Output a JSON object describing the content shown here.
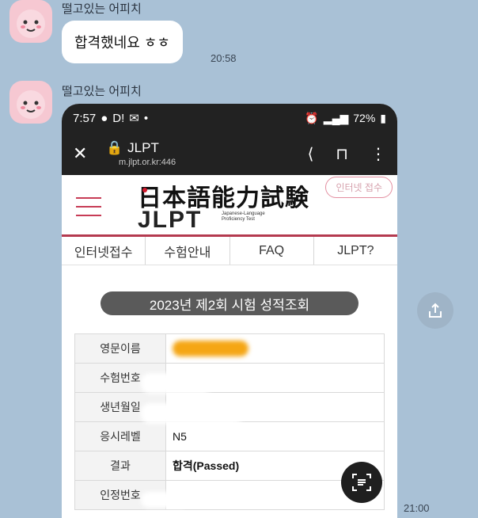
{
  "chat": {
    "sender_name": "떨고있는 어피치",
    "messages": [
      {
        "text": "합격했네요 ㅎㅎ",
        "time": "20:58"
      },
      {
        "time": "21:00"
      }
    ]
  },
  "phone": {
    "status": {
      "time": "7:57",
      "indicators": "D! ",
      "battery": "72%"
    },
    "browser": {
      "title": "JLPT",
      "host": "m.jlpt.or.kr:446"
    },
    "site": {
      "logo_jp": "日本語能力試験",
      "logo_en": "JLPT",
      "logo_sub": "Japanese-Language Proficiency Test",
      "header_button": "인터넷 접수",
      "nav": [
        "인터넷접수",
        "수험안내",
        "FAQ",
        "JLPT?"
      ],
      "result_title": "2023년 제2회   시험 성적조회",
      "rows": [
        {
          "label": "영문이름",
          "value": ""
        },
        {
          "label": "수험번호",
          "value": ""
        },
        {
          "label": "생년월일",
          "value": ""
        },
        {
          "label": "응시레벨",
          "value": "N5"
        },
        {
          "label": "결과",
          "value": "합격(Passed)"
        },
        {
          "label": "인정번호",
          "value": ""
        }
      ]
    }
  },
  "colors": {
    "chat_bg": "#a9c1d6",
    "accent": "#c73c56",
    "redact": "#f5a614"
  }
}
